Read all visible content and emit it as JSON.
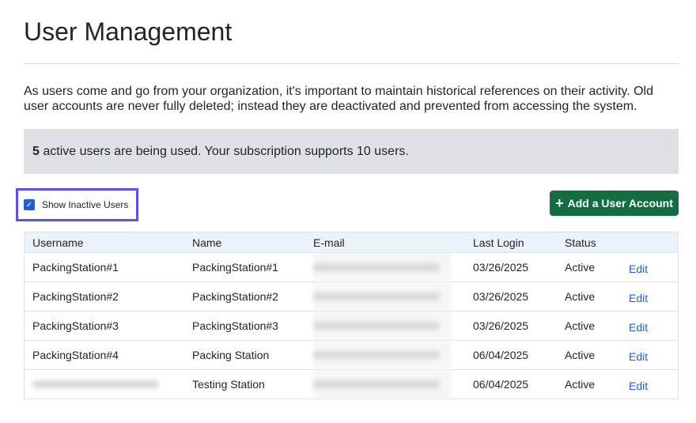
{
  "title": "User Management",
  "intro": "As users come and go from your organization, it's important to maintain historical references on their activity. Old user accounts are never fully deleted; instead they are deactivated and prevented from accessing the system.",
  "info": {
    "count": "5",
    "text": " active users are being used. Your subscription supports 10 users."
  },
  "show_inactive": {
    "label": "Show Inactive Users",
    "checked": true
  },
  "add_button": "Add a User Account",
  "table": {
    "headers": [
      "Username",
      "Name",
      "E-mail",
      "Last Login",
      "Status",
      ""
    ],
    "rows": [
      {
        "username": "PackingStation#1",
        "name": "PackingStation#1",
        "last_login": "03/26/2025",
        "status": "Active",
        "action": "Edit"
      },
      {
        "username": "PackingStation#2",
        "name": "PackingStation#2",
        "last_login": "03/26/2025",
        "status": "Active",
        "action": "Edit"
      },
      {
        "username": "PackingStation#3",
        "name": "PackingStation#3",
        "last_login": "03/26/2025",
        "status": "Active",
        "action": "Edit"
      },
      {
        "username": "PackingStation#4",
        "name": "Packing Station",
        "last_login": "06/04/2025",
        "status": "Active",
        "action": "Edit"
      },
      {
        "username": null,
        "name": "Testing Station",
        "last_login": "06/04/2025",
        "status": "Active",
        "action": "Edit"
      }
    ]
  },
  "colors": {
    "accent": "#146c43",
    "link": "#1f5fd6",
    "highlight": "#5b4ff5"
  }
}
